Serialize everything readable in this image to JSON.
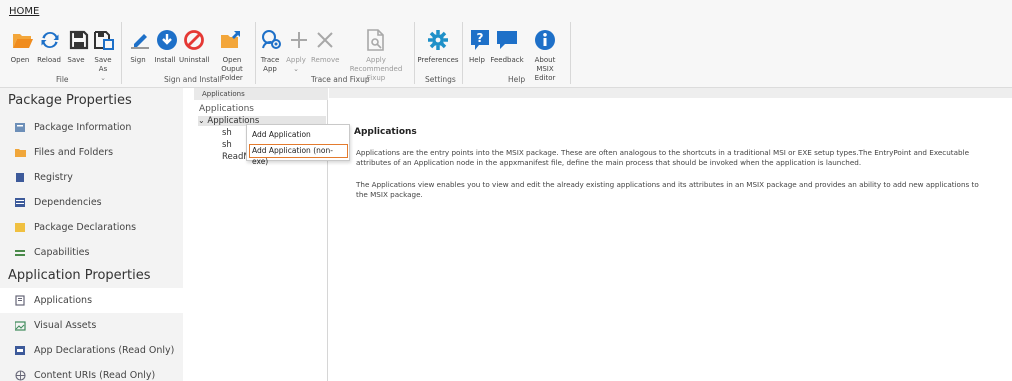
{
  "ribbon": {
    "tab": "HOME",
    "buttons": {
      "open": "Open",
      "reload": "Reload",
      "save": "Save",
      "save_as": "Save As",
      "sign": "Sign",
      "install": "Install",
      "uninstall": "Uninstall",
      "open_output_folder_1": "Open Ouput",
      "open_output_folder_2": "Folder",
      "trace_app_1": "Trace",
      "trace_app_2": "App",
      "apply": "Apply",
      "remove": "Remove",
      "apply_recommended_fixup_1": "Apply Recommended",
      "apply_recommended_fixup_2": "Fixup",
      "preferences": "Preferences",
      "help": "Help",
      "feedback": "Feedback",
      "about_1": "About MSIX",
      "about_2": "Editor"
    },
    "groups": {
      "file": "File",
      "sign_install": "Sign and Install",
      "trace_fixup": "Trace and Fixup",
      "settings": "Settings",
      "help": "Help"
    },
    "colors": {
      "orange": "#f08c1e",
      "blue": "#1e70c8",
      "red": "#e53935",
      "teal": "#1e90c8"
    }
  },
  "sidebar": {
    "package_heading": "Package Properties",
    "package_items": [
      {
        "label": "Package Information",
        "icon": "package-info-icon"
      },
      {
        "label": "Files and Folders",
        "icon": "folder-icon"
      },
      {
        "label": "Registry",
        "icon": "registry-icon"
      },
      {
        "label": "Dependencies",
        "icon": "dependencies-icon"
      },
      {
        "label": "Package Declarations",
        "icon": "declarations-icon"
      },
      {
        "label": "Capabilities",
        "icon": "capabilities-icon"
      }
    ],
    "application_heading": "Application Properties",
    "application_items": [
      {
        "label": "Applications",
        "icon": "applications-icon",
        "active": true
      },
      {
        "label": "Visual Assets",
        "icon": "visual-assets-icon"
      },
      {
        "label": "App Declarations (Read Only)",
        "icon": "app-declarations-icon"
      },
      {
        "label": "Content URIs (Read Only)",
        "icon": "content-uris-icon"
      }
    ]
  },
  "tree": {
    "tab": "Applications",
    "title": "Applications",
    "root": "Applications",
    "children": [
      "sh",
      "sh",
      "ReadMe"
    ]
  },
  "context_menu": {
    "items": [
      "Add Application",
      "Add Application (non-exe)"
    ],
    "highlight_color": "#e37b2e"
  },
  "main": {
    "title": "Applications",
    "para1_line1": "Applications are the entry points into the MSIX package. These are often analogous to the shortcuts in a traditional MSI or EXE setup types.The EntryPoint and Executable",
    "para1_line2": "attributes of an Application node in the appxmanifest file, define the main process that should be invoked when the application is launched.",
    "para2_line1": "The Applications view enables you to view and edit the already existing applications and its attributes in an MSIX package and provides an ability to add new applications to",
    "para2_line2": "the MSIX package."
  }
}
